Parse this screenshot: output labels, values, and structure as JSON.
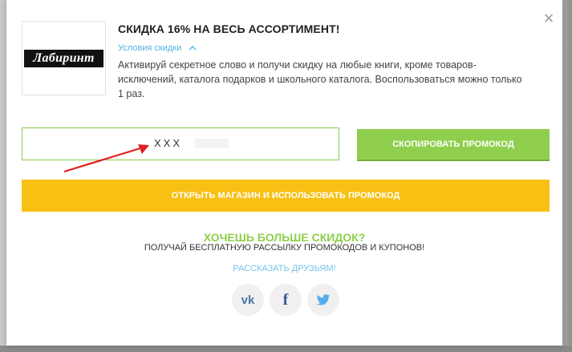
{
  "modal": {
    "title": "СКИДКА 16% НА ВЕСЬ АССОРТИМЕНТ!",
    "conditions_link": "Условия скидки",
    "description": "Активируй секретное слово и получи скидку на любые книги, кроме товаров-исключений, каталога подарков и школьного каталога. Воспользоваться можно только 1 раз.",
    "logo_text": "Лабиринт",
    "close_symbol": "×"
  },
  "promo": {
    "code": "XXX",
    "copy_button": "СКОПИРОВАТЬ ПРОМОКОД",
    "open_shop_button": "ОТКРЫТЬ МАГАЗИН И ИСПОЛЬЗОВАТЬ ПРОМОКОД"
  },
  "subscribe": {
    "title": "ХОЧЕШЬ БОЛЬШЕ СКИДОК?",
    "subtitle": "ПОЛУЧАЙ БЕСПЛАТНУЮ РАССЫЛКУ ПРОМОКОДОВ И КУПОНОВ!",
    "share_link": "РАССКАЗАТЬ ДРУЗЬЯМ!"
  },
  "social": {
    "vk_icon": "vk-icon",
    "facebook_icon": "facebook-icon",
    "twitter_icon": "twitter-icon"
  },
  "colors": {
    "accent_green": "#8fcf4d",
    "accent_yellow": "#f7c013",
    "link_blue": "#4fb3e6",
    "arrow_red": "#e02020"
  }
}
